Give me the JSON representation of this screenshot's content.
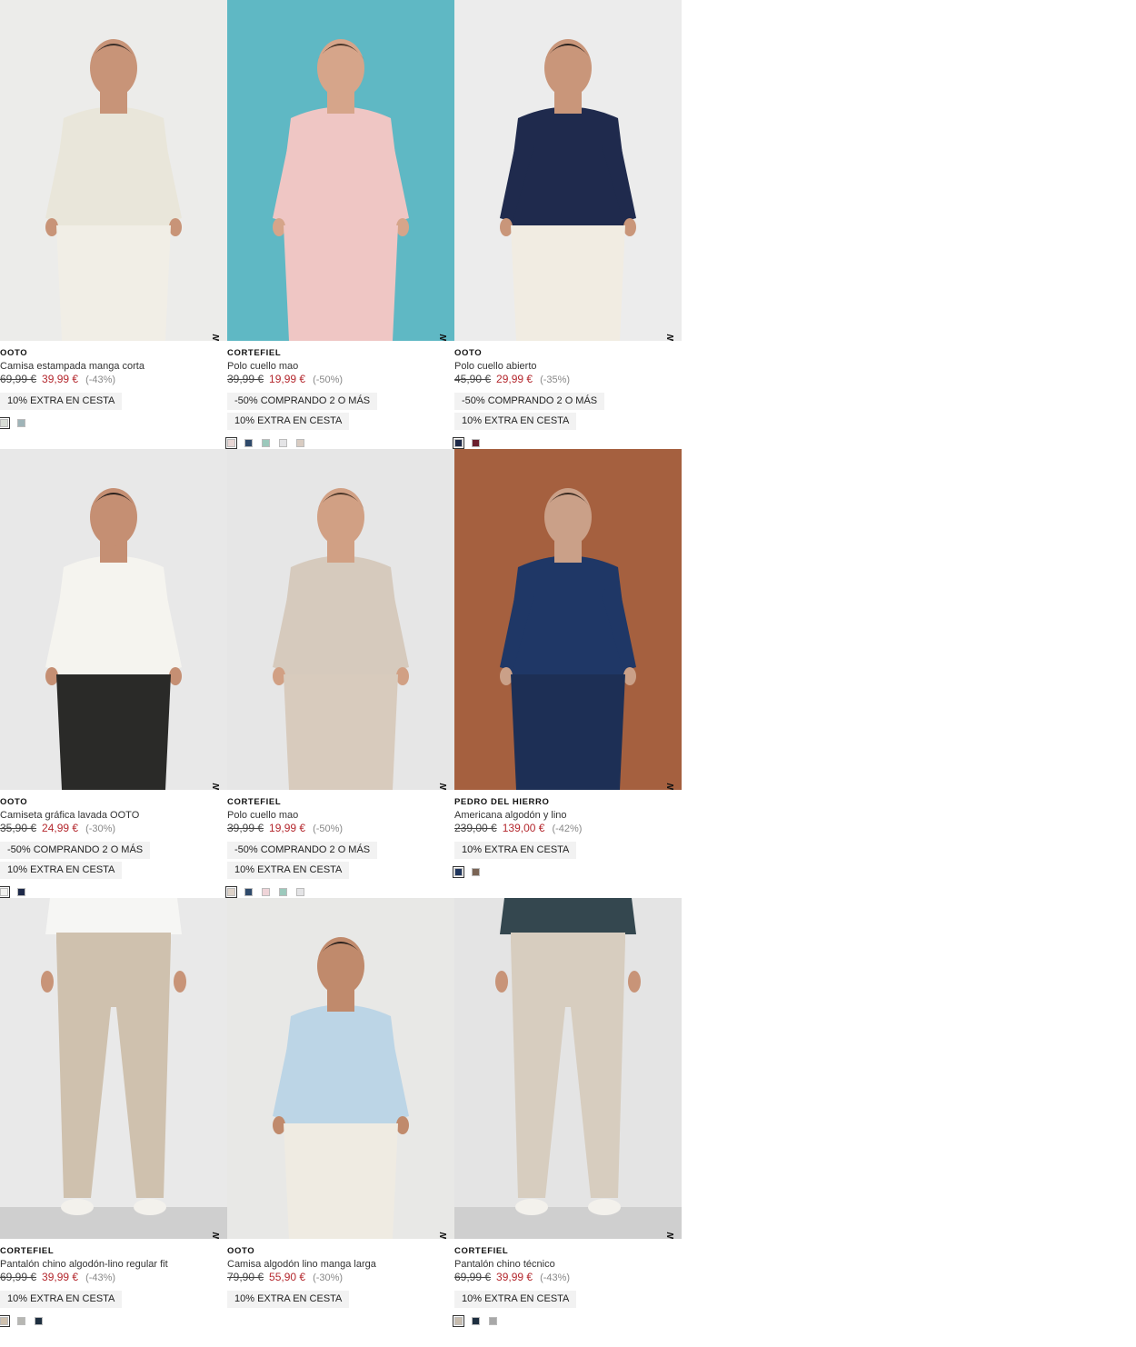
{
  "new_label": "NEW",
  "products": [
    {
      "brand": "OOTO",
      "name": "Camisa estampada manga corta",
      "old_price": "69,99 €",
      "price": "39,99 €",
      "discount": "(-43%)",
      "promos": [
        "10% EXTRA EN CESTA"
      ],
      "swatches": [
        "#d8ddd6",
        "#9fb4b8"
      ],
      "photo": {
        "bg": "#ececea",
        "top": "#e9e6da",
        "bottom": "#f1eee6",
        "skin": "#c89478",
        "hair": "#3a2e28"
      }
    },
    {
      "brand": "CORTEFIEL",
      "name": "Polo cuello mao",
      "old_price": "39,99 €",
      "price": "19,99 €",
      "discount": "(-50%)",
      "promos": [
        "-50% COMPRANDO 2 O MÁS",
        "10% EXTRA EN CESTA"
      ],
      "swatches": [
        "#e8d6d4",
        "#2f4a6b",
        "#9cc9bc",
        "#e4e4e6",
        "#d9ccc2"
      ],
      "photo": {
        "bg": "#5fb8c4",
        "top": "#efc6c4",
        "bottom": "#efc6c4",
        "skin": "#d6a58a",
        "hair": "#4a3528"
      }
    },
    {
      "brand": "OOTO",
      "name": "Polo cuello abierto",
      "old_price": "45,90 €",
      "price": "29,99 €",
      "discount": "(-35%)",
      "promos": [
        "-50% COMPRANDO 2 O MÁS",
        "10% EXTRA EN CESTA"
      ],
      "swatches": [
        "#1e2a4a",
        "#6b1e2c"
      ],
      "photo": {
        "bg": "#ececec",
        "top": "#1f2a4d",
        "bottom": "#f1ece2",
        "skin": "#c9967a",
        "hair": "#2a211d"
      }
    },
    {
      "brand": "OOTO",
      "name": "Camiseta gráfica lavada OOTO",
      "old_price": "35,90 €",
      "price": "24,99 €",
      "discount": "(-30%)",
      "promos": [
        "-50% COMPRANDO 2 O MÁS",
        "10% EXTRA EN CESTA"
      ],
      "swatches": [
        "#f1f1ef",
        "#1e2a4a"
      ],
      "photo": {
        "bg": "#e8e8e8",
        "top": "#f5f4ef",
        "bottom": "#2a2a28",
        "skin": "#c58f73",
        "hair": "#2a211d"
      }
    },
    {
      "brand": "CORTEFIEL",
      "name": "Polo cuello mao",
      "old_price": "39,99 €",
      "price": "19,99 €",
      "discount": "(-50%)",
      "promos": [
        "-50% COMPRANDO 2 O MÁS",
        "10% EXTRA EN CESTA"
      ],
      "swatches": [
        "#ddd2c8",
        "#2f4a6b",
        "#efd4d8",
        "#9cc9bc",
        "#e4e4e6"
      ],
      "photo": {
        "bg": "#e6e6e6",
        "top": "#d6cabd",
        "bottom": "#d8cbbd",
        "skin": "#d1a084",
        "hair": "#4a3528"
      }
    },
    {
      "brand": "PEDRO DEL HIERRO",
      "name": "Americana algodón y lino",
      "old_price": "239,00 €",
      "price": "139,00 €",
      "discount": "(-42%)",
      "promos": [
        "10% EXTRA EN CESTA"
      ],
      "swatches": [
        "#20365e",
        "#7a6455"
      ],
      "photo": {
        "bg": "#a5603f",
        "top": "#1f3766",
        "bottom": "#1d2f55",
        "skin": "#caa088",
        "hair": "#3a2a20"
      }
    },
    {
      "brand": "CORTEFIEL",
      "name": "Pantalón chino algodón-lino regular fit",
      "old_price": "69,99 €",
      "price": "39,99 €",
      "discount": "(-43%)",
      "promos": [
        "10% EXTRA EN CESTA"
      ],
      "swatches": [
        "#cfc1ae",
        "#b7b7b3",
        "#1e2f40"
      ],
      "photo": {
        "bg": "#e9e9e9",
        "top": "#f6f6f4",
        "bottom": "#cfc1ae",
        "skin": "#c89478",
        "hair": "#3a2e28"
      }
    },
    {
      "brand": "OOTO",
      "name": "Camisa algodón lino manga larga",
      "old_price": "79,90 €",
      "price": "55,90 €",
      "discount": "(-30%)",
      "promos": [
        "10% EXTRA EN CESTA"
      ],
      "swatches": [],
      "photo": {
        "bg": "#e8e8e6",
        "top": "#bcd5e6",
        "bottom": "#efebe2",
        "skin": "#c08a6c",
        "hair": "#2a211d"
      }
    },
    {
      "brand": "CORTEFIEL",
      "name": "Pantalón chino técnico",
      "old_price": "69,99 €",
      "price": "39,99 €",
      "discount": "(-43%)",
      "promos": [
        "10% EXTRA EN CESTA"
      ],
      "swatches": [
        "#c7bcae",
        "#1e2f40",
        "#a8a8a8"
      ],
      "photo": {
        "bg": "#e4e4e4",
        "top": "#34474f",
        "bottom": "#d7cdbf",
        "skin": "#c89478",
        "hair": "#3a2e28"
      }
    }
  ]
}
